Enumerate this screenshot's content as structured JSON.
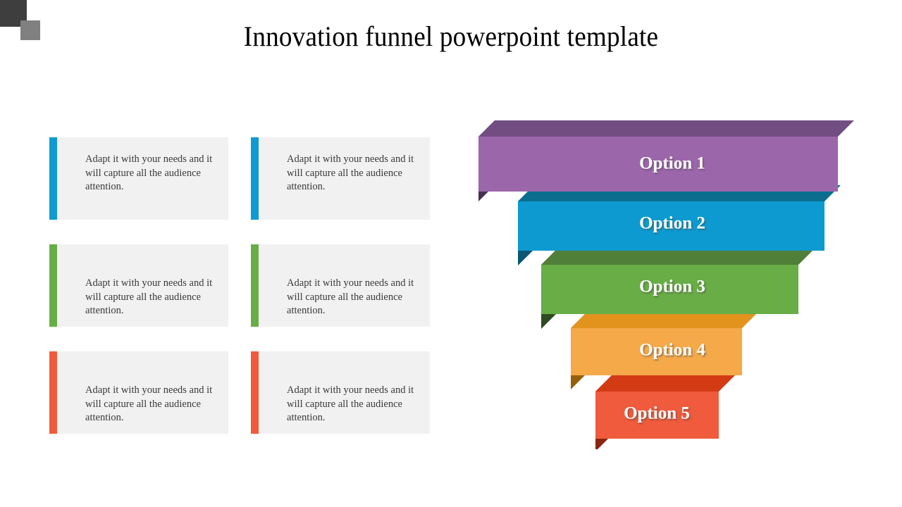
{
  "slide": {
    "title": "Innovation funnel powerpoint template",
    "background_color": "#ffffff"
  },
  "decoration": {
    "corner_dark_color": "#3e3e3e",
    "corner_light_color": "#808080"
  },
  "cards": [
    {
      "text": "Adapt it with your needs and it will capture all the audience attention.",
      "accent_color": "#0f9bd1",
      "row": 1,
      "column": 1
    },
    {
      "text": "Adapt it with your needs and it will capture all the audience attention.",
      "accent_color": "#0f9bd1",
      "row": 1,
      "column": 2
    },
    {
      "text": "Adapt it with your needs and it will capture all the audience attention.",
      "accent_color": "#68ad46",
      "row": 2,
      "column": 1
    },
    {
      "text": "Adapt it with your needs and it will capture all the audience attention.",
      "accent_color": "#68ad46",
      "row": 2,
      "column": 2
    },
    {
      "text": "Adapt it with your needs and it will capture all the audience attention.",
      "accent_color": "#ef5b3c",
      "row": 3,
      "column": 1
    },
    {
      "text": "Adapt it with your needs and it will capture all the audience attention.",
      "accent_color": "#ef5b3c",
      "row": 3,
      "column": 2
    }
  ],
  "funnel": {
    "levels": [
      {
        "label": "Option 1",
        "front_color": "#9c66ab",
        "top_color": "#724d82",
        "side_color": "#4a2f55"
      },
      {
        "label": "Option 2",
        "front_color": "#0d9ad0",
        "top_color": "#0b6e8f",
        "side_color": "#0a5873"
      },
      {
        "label": "Option 3",
        "front_color": "#68ad46",
        "top_color": "#4f7f38",
        "side_color": "#2f4c21"
      },
      {
        "label": "Option 4",
        "front_color": "#f5a949",
        "top_color": "#e2931e",
        "side_color": "#96600b"
      },
      {
        "label": "Option 5",
        "front_color": "#ef5b3c",
        "top_color": "#d33b15",
        "side_color": "#8b2411"
      }
    ]
  },
  "chart_data": {
    "type": "funnel",
    "title": "Innovation funnel powerpoint template",
    "stages": [
      "Option 1",
      "Option 2",
      "Option 3",
      "Option 4",
      "Option 5"
    ],
    "relative_widths": [
      510,
      435,
      365,
      243,
      175
    ],
    "colors": [
      "#9c66ab",
      "#0d9ad0",
      "#68ad46",
      "#f5a949",
      "#ef5b3c"
    ],
    "legend": "none",
    "grid": false
  }
}
